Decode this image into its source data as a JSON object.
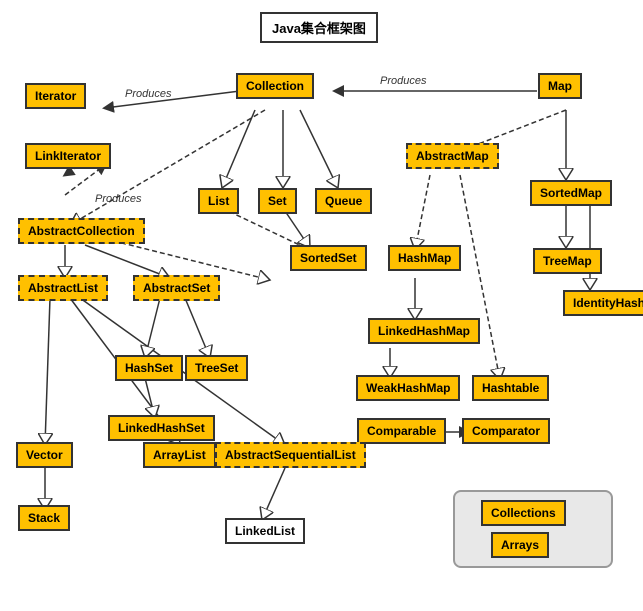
{
  "title": "Java集合框架图",
  "nodes": {
    "iterator": "Iterator",
    "collection": "Collection",
    "map": "Map",
    "linkiterator": "LinkIterator",
    "list": "List",
    "set": "Set",
    "queue": "Queue",
    "abstractmap": "AbstractMap",
    "sortedmap": "SortedMap",
    "abstractcollection": "AbstractCollection",
    "sortedset": "SortedSet",
    "hashmap": "HashMap",
    "treemap": "TreeMap",
    "identityhashmap": "IdentityHashMap",
    "abstractlist": "AbstractList",
    "abstractset": "AbstractSet",
    "linkedhashmap": "LinkedHashMap",
    "hashset": "HashSet",
    "treeset": "TreeSet",
    "weakhashmap": "WeakHashMap",
    "hashtable": "Hashtable",
    "linkedhashset": "LinkedHashSet",
    "comparable": "Comparable",
    "comparator": "Comparator",
    "vector": "Vector",
    "arraylist": "ArrayList",
    "abstractsequentiallist": "AbstractSequentialList",
    "stack": "Stack",
    "linkedlist": "LinkedList"
  },
  "labels": {
    "produces": "Produces"
  },
  "legend": {
    "collections": "Collections",
    "arrays": "Arrays"
  }
}
